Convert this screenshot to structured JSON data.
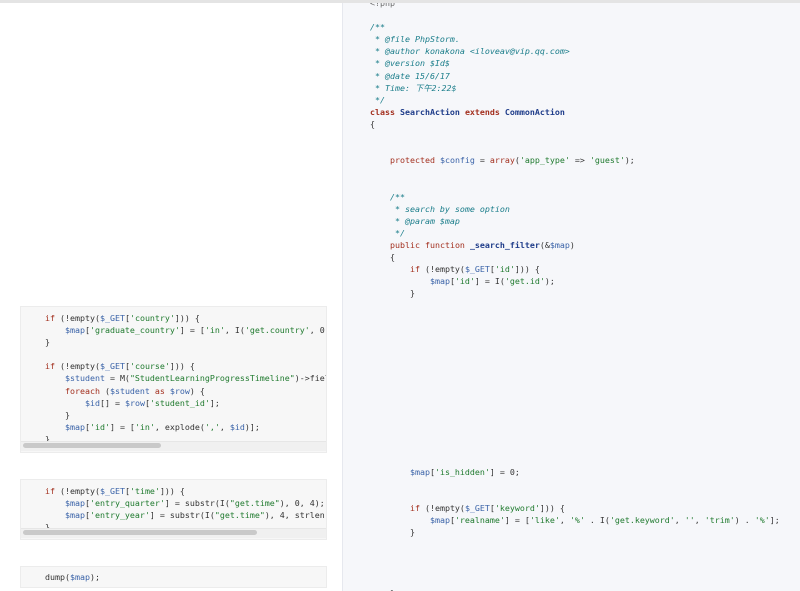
{
  "code_right_top": [
    "<?php",
    "",
    "/**",
    " * @file PhpStorm.",
    " * @author konakona <iloveav@vip.qq.com>",
    " * @version $Id$",
    " * @date 15/6/17",
    " * Time: 下午2:22$",
    " */",
    "class SearchAction extends CommonAction",
    "{",
    "",
    "",
    "    protected $config = array('app_type' => 'guest');",
    "",
    "",
    "    /**",
    "     * search by some option",
    "     * @param $map",
    "     */",
    "    public function _search_filter(&$map)",
    "    {",
    "        if (!empty($_GET['id'])) {",
    "            $map['id'] = I('get.id');",
    "        }"
  ],
  "code_right_bottom": [
    "        $map['is_hidden'] = 0;",
    "",
    "",
    "        if (!empty($_GET['keyword'])) {",
    "            $map['realname'] = ['like', '%' . I('get.keyword', '', 'trim') . '%'];",
    "        }",
    "",
    "",
    "",
    "",
    "    }"
  ],
  "snippet_country_course": [
    "if (!empty($_GET['country'])) {",
    "    $map['graduate_country'] = ['in', I('get.country', 0,",
    "}",
    "",
    "if (!empty($_GET['course'])) {",
    "    $student = M(\"StudentLearningProgressTimeline\")->field",
    "    foreach ($student as $row) {",
    "        $id[] = $row['student_id'];",
    "    }",
    "    $map['id'] = ['in', explode(',', $id)];",
    "}"
  ],
  "snippet_time": [
    "if (!empty($_GET['time'])) {",
    "    $map['entry_quarter'] = substr(I(\"get.time\"), 0, 4);",
    "    $map['entry_year'] = substr(I(\"get.time\"), 4, strlen(I",
    "}"
  ],
  "snippet_dump": [
    "dump($map);"
  ],
  "scrollbar_fraction_1": 0.46,
  "scrollbar_fraction_2": 0.78
}
